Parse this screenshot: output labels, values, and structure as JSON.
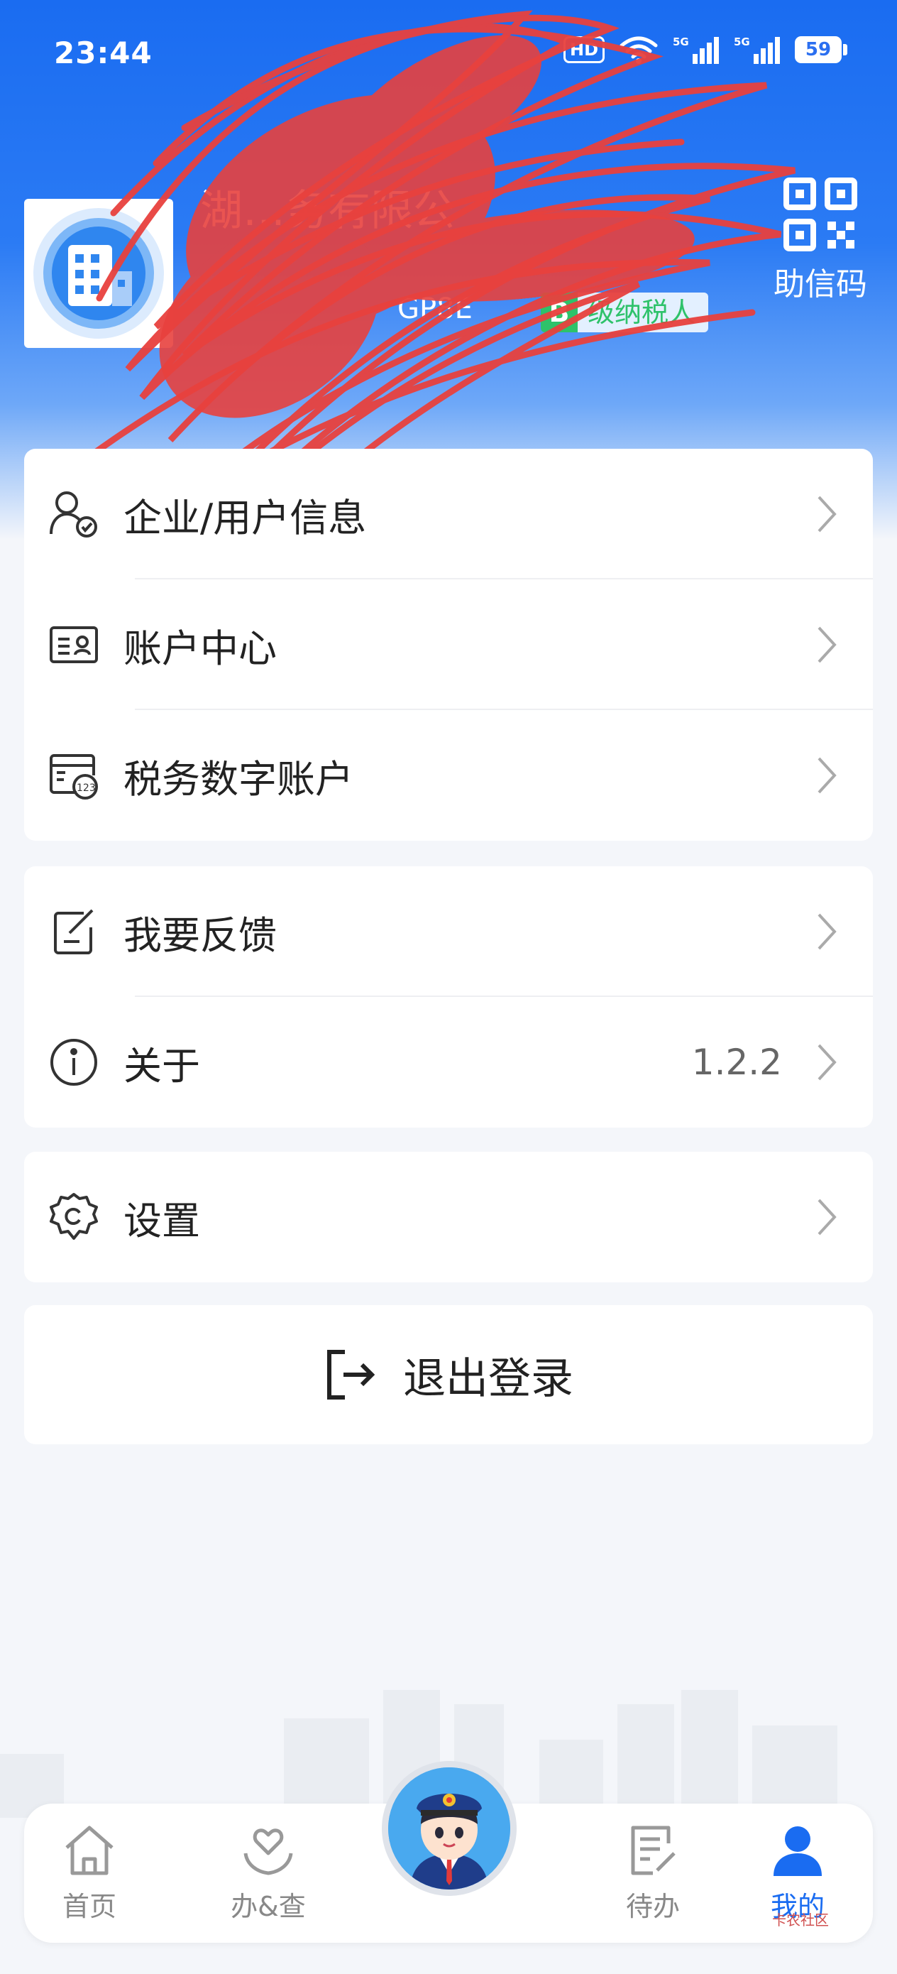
{
  "status_bar": {
    "time": "23:44",
    "hd": "HD",
    "battery": "59"
  },
  "profile": {
    "company_name": "湖…务有限公",
    "tax_id": "GP8E",
    "taxpayer_level": "B",
    "taxpayer_suffix": "级纳税人",
    "qr_label": "助信码"
  },
  "menu_group_1": [
    {
      "label": "企业/用户信息"
    },
    {
      "label": "账户中心"
    },
    {
      "label": "税务数字账户"
    }
  ],
  "menu_group_2": [
    {
      "label": "我要反馈"
    },
    {
      "label": "关于",
      "value": "1.2.2"
    }
  ],
  "menu_group_3": [
    {
      "label": "设置"
    }
  ],
  "logout": {
    "label": "退出登录"
  },
  "bottom_nav": {
    "home": "首页",
    "handle_query": "办&查",
    "todo": "待办",
    "mine": "我的",
    "active_color": "#1a6cf1"
  },
  "icons": {
    "user": "user-check-icon",
    "account": "id-card-icon",
    "digital": "digital-account-icon",
    "feedback": "edit-note-icon",
    "about": "info-icon",
    "settings": "gear-icon",
    "logout": "logout-icon",
    "qr": "qr-code-icon"
  }
}
